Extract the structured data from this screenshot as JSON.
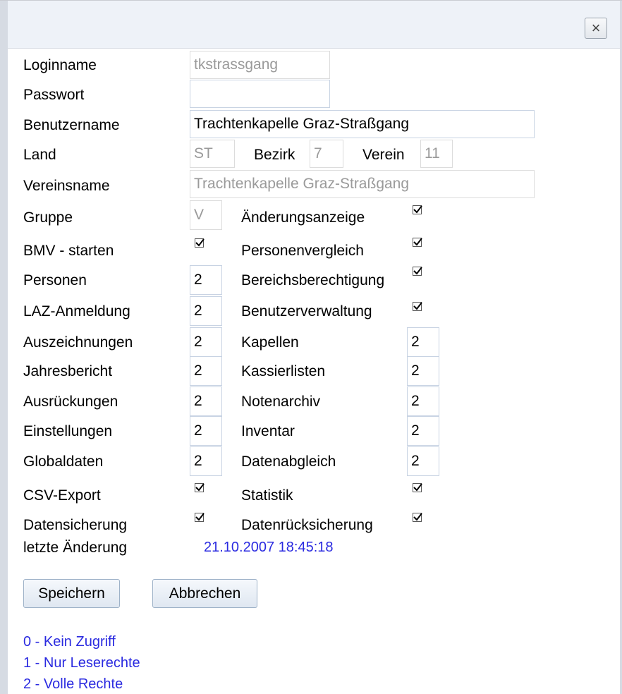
{
  "dialog": {
    "close_label": "×"
  },
  "fields": {
    "loginname": {
      "label": "Loginname",
      "value": "tkstrassgang"
    },
    "passwort": {
      "label": "Passwort",
      "value": ""
    },
    "benutzername": {
      "label": "Benutzername",
      "value": "Trachtenkapelle Graz-Straßgang"
    },
    "land": {
      "label": "Land",
      "value": "ST"
    },
    "bezirk": {
      "label": "Bezirk",
      "value": "7"
    },
    "verein": {
      "label": "Verein",
      "value": "11"
    },
    "vereinsname": {
      "label": "Vereinsname",
      "value": "Trachtenkapelle Graz-Straßgang"
    },
    "gruppe": {
      "label": "Gruppe",
      "value": "V"
    }
  },
  "perms_left": [
    {
      "label": "BMV - starten",
      "type": "checkbox",
      "checked": true
    },
    {
      "label": "Personen",
      "type": "text",
      "value": "2"
    },
    {
      "label": "LAZ-Anmeldung",
      "type": "text",
      "value": "2"
    },
    {
      "label": "Auszeichnungen",
      "type": "text",
      "value": "2"
    },
    {
      "label": "Jahresbericht",
      "type": "text",
      "value": "2"
    },
    {
      "label": "Ausrückungen",
      "type": "text",
      "value": "2"
    },
    {
      "label": "Einstellungen",
      "type": "text",
      "value": "2"
    },
    {
      "label": "Globaldaten",
      "type": "text",
      "value": "2"
    },
    {
      "label": "CSV-Export",
      "type": "checkbox",
      "checked": true
    },
    {
      "label": "Datensicherung",
      "type": "checkbox",
      "checked": true
    }
  ],
  "perms_right": [
    {
      "label": "Änderungsanzeige",
      "type": "checkbox",
      "checked": true
    },
    {
      "label": "Personenvergleich",
      "type": "checkbox",
      "checked": true
    },
    {
      "label": "Bereichsberechtigung",
      "type": "checkbox",
      "checked": true
    },
    {
      "label": "Benutzerverwaltung",
      "type": "checkbox",
      "checked": true
    },
    {
      "label": "Kapellen",
      "type": "text",
      "value": "2"
    },
    {
      "label": "Kassierlisten",
      "type": "text",
      "value": "2"
    },
    {
      "label": "Notenarchiv",
      "type": "text",
      "value": "2"
    },
    {
      "label": "Inventar",
      "type": "text",
      "value": "2"
    },
    {
      "label": "Datenabgleich",
      "type": "text",
      "value": "2"
    },
    {
      "label": "Statistik",
      "type": "checkbox",
      "checked": true
    },
    {
      "label": "Datenrücksicherung",
      "type": "checkbox",
      "checked": true
    }
  ],
  "last_change": {
    "label": "letzte Änderung",
    "value": "21.10.2007 18:45:18"
  },
  "buttons": {
    "save": "Speichern",
    "cancel": "Abbrechen"
  },
  "legend": [
    "0 - Kein Zugriff",
    "1 - Nur Leserechte",
    "2 - Volle Rechte"
  ],
  "colors": {
    "link_blue": "#2a2ae0",
    "titlebar": "#eef2f8",
    "input_border": "#c8d3e3"
  }
}
